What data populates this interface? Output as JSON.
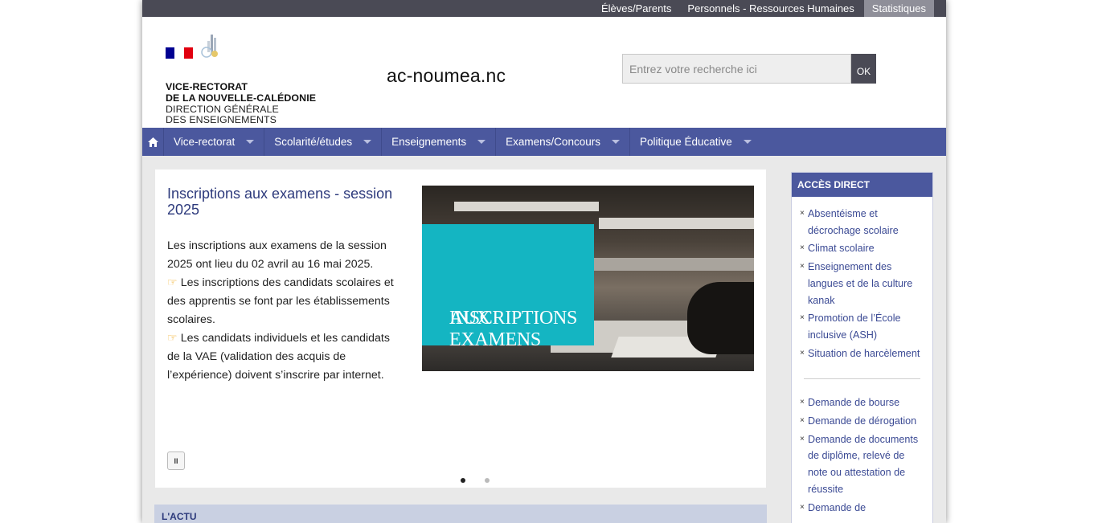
{
  "topbar": {
    "links": [
      "Élèves/Parents",
      "Personnels - Ressources Humaines",
      "Statistiques"
    ]
  },
  "header": {
    "logo_lines": [
      "VICE-RECTORAT",
      "DE LA NOUVELLE-CALÉDONIE",
      "DIRECTION GÉNÉRALE",
      "DES ENSEIGNEMENTS"
    ],
    "site_name": "ac-noumea.nc",
    "search_placeholder": "Entrez votre recherche ici",
    "search_button": "OK",
    "flag_colors": [
      "#000091",
      "#ffffff",
      "#e1000f"
    ]
  },
  "nav": {
    "home_icon": "home-icon",
    "items": [
      "Vice-rectorat",
      "Scolarité/études",
      "Enseignements",
      "Examens/Concours",
      "Politique Éducative"
    ]
  },
  "slider": {
    "title": "Inscriptions aux examens - session 2025",
    "paragraph1": "Les inscriptions aux examens de la session 2025 ont lieu du 02 avril au 16 mai 2025.",
    "bullet1": "Les inscriptions des candidats scolaires et des apprentis se font par les établissements scolaires.",
    "bullet2": "Les candidats individuels et les candidats de la VAE (validation des acquis de l’expérience) doivent s’inscrire par internet.",
    "bullet_icon": "pointing-hand-icon",
    "image_text_line1": "INSCRIPTIONS",
    "image_text_line2": "AUX EXAMENS",
    "pause_label": "II",
    "dots_count": 2,
    "active_dot": 1
  },
  "actu": {
    "label": "L'ACTU"
  },
  "sidebar": {
    "title": "ACCÈS DIRECT",
    "group1": [
      "Absentéisme et décrochage scolaire",
      "Climat scolaire",
      "Enseignement des langues et de la culture kanak",
      "Promotion de l’École inclusive (ASH)",
      "Situation de harcèlement"
    ],
    "group2": [
      "Demande de bourse",
      "Demande de dérogation",
      "Demande de documents de diplôme, relevé de note ou attestation de réussite",
      "Demande de"
    ]
  },
  "colors": {
    "nav": "#4b589e",
    "topbar": "#4a4a55",
    "accent_text": "#2d3a7c",
    "image_panel": "#14b5c2"
  }
}
